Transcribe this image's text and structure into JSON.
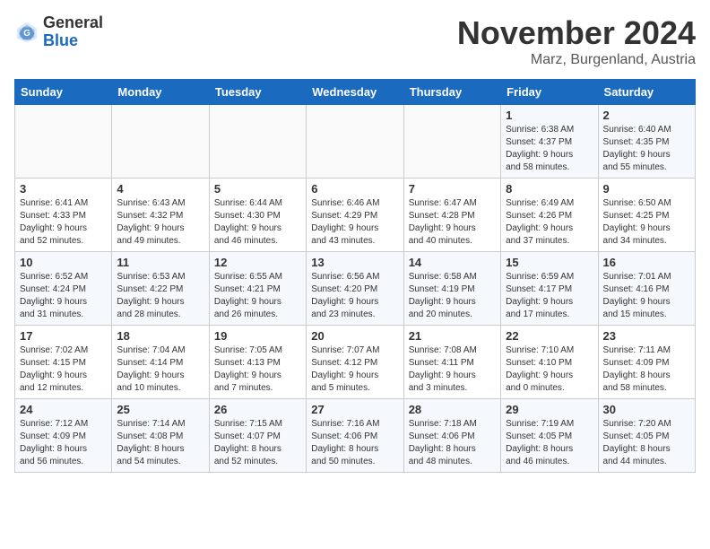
{
  "logo": {
    "general": "General",
    "blue": "Blue"
  },
  "title": "November 2024",
  "subtitle": "Marz, Burgenland, Austria",
  "weekdays": [
    "Sunday",
    "Monday",
    "Tuesday",
    "Wednesday",
    "Thursday",
    "Friday",
    "Saturday"
  ],
  "weeks": [
    [
      {
        "day": "",
        "info": ""
      },
      {
        "day": "",
        "info": ""
      },
      {
        "day": "",
        "info": ""
      },
      {
        "day": "",
        "info": ""
      },
      {
        "day": "",
        "info": ""
      },
      {
        "day": "1",
        "info": "Sunrise: 6:38 AM\nSunset: 4:37 PM\nDaylight: 9 hours\nand 58 minutes."
      },
      {
        "day": "2",
        "info": "Sunrise: 6:40 AM\nSunset: 4:35 PM\nDaylight: 9 hours\nand 55 minutes."
      }
    ],
    [
      {
        "day": "3",
        "info": "Sunrise: 6:41 AM\nSunset: 4:33 PM\nDaylight: 9 hours\nand 52 minutes."
      },
      {
        "day": "4",
        "info": "Sunrise: 6:43 AM\nSunset: 4:32 PM\nDaylight: 9 hours\nand 49 minutes."
      },
      {
        "day": "5",
        "info": "Sunrise: 6:44 AM\nSunset: 4:30 PM\nDaylight: 9 hours\nand 46 minutes."
      },
      {
        "day": "6",
        "info": "Sunrise: 6:46 AM\nSunset: 4:29 PM\nDaylight: 9 hours\nand 43 minutes."
      },
      {
        "day": "7",
        "info": "Sunrise: 6:47 AM\nSunset: 4:28 PM\nDaylight: 9 hours\nand 40 minutes."
      },
      {
        "day": "8",
        "info": "Sunrise: 6:49 AM\nSunset: 4:26 PM\nDaylight: 9 hours\nand 37 minutes."
      },
      {
        "day": "9",
        "info": "Sunrise: 6:50 AM\nSunset: 4:25 PM\nDaylight: 9 hours\nand 34 minutes."
      }
    ],
    [
      {
        "day": "10",
        "info": "Sunrise: 6:52 AM\nSunset: 4:24 PM\nDaylight: 9 hours\nand 31 minutes."
      },
      {
        "day": "11",
        "info": "Sunrise: 6:53 AM\nSunset: 4:22 PM\nDaylight: 9 hours\nand 28 minutes."
      },
      {
        "day": "12",
        "info": "Sunrise: 6:55 AM\nSunset: 4:21 PM\nDaylight: 9 hours\nand 26 minutes."
      },
      {
        "day": "13",
        "info": "Sunrise: 6:56 AM\nSunset: 4:20 PM\nDaylight: 9 hours\nand 23 minutes."
      },
      {
        "day": "14",
        "info": "Sunrise: 6:58 AM\nSunset: 4:19 PM\nDaylight: 9 hours\nand 20 minutes."
      },
      {
        "day": "15",
        "info": "Sunrise: 6:59 AM\nSunset: 4:17 PM\nDaylight: 9 hours\nand 17 minutes."
      },
      {
        "day": "16",
        "info": "Sunrise: 7:01 AM\nSunset: 4:16 PM\nDaylight: 9 hours\nand 15 minutes."
      }
    ],
    [
      {
        "day": "17",
        "info": "Sunrise: 7:02 AM\nSunset: 4:15 PM\nDaylight: 9 hours\nand 12 minutes."
      },
      {
        "day": "18",
        "info": "Sunrise: 7:04 AM\nSunset: 4:14 PM\nDaylight: 9 hours\nand 10 minutes."
      },
      {
        "day": "19",
        "info": "Sunrise: 7:05 AM\nSunset: 4:13 PM\nDaylight: 9 hours\nand 7 minutes."
      },
      {
        "day": "20",
        "info": "Sunrise: 7:07 AM\nSunset: 4:12 PM\nDaylight: 9 hours\nand 5 minutes."
      },
      {
        "day": "21",
        "info": "Sunrise: 7:08 AM\nSunset: 4:11 PM\nDaylight: 9 hours\nand 3 minutes."
      },
      {
        "day": "22",
        "info": "Sunrise: 7:10 AM\nSunset: 4:10 PM\nDaylight: 9 hours\nand 0 minutes."
      },
      {
        "day": "23",
        "info": "Sunrise: 7:11 AM\nSunset: 4:09 PM\nDaylight: 8 hours\nand 58 minutes."
      }
    ],
    [
      {
        "day": "24",
        "info": "Sunrise: 7:12 AM\nSunset: 4:09 PM\nDaylight: 8 hours\nand 56 minutes."
      },
      {
        "day": "25",
        "info": "Sunrise: 7:14 AM\nSunset: 4:08 PM\nDaylight: 8 hours\nand 54 minutes."
      },
      {
        "day": "26",
        "info": "Sunrise: 7:15 AM\nSunset: 4:07 PM\nDaylight: 8 hours\nand 52 minutes."
      },
      {
        "day": "27",
        "info": "Sunrise: 7:16 AM\nSunset: 4:06 PM\nDaylight: 8 hours\nand 50 minutes."
      },
      {
        "day": "28",
        "info": "Sunrise: 7:18 AM\nSunset: 4:06 PM\nDaylight: 8 hours\nand 48 minutes."
      },
      {
        "day": "29",
        "info": "Sunrise: 7:19 AM\nSunset: 4:05 PM\nDaylight: 8 hours\nand 46 minutes."
      },
      {
        "day": "30",
        "info": "Sunrise: 7:20 AM\nSunset: 4:05 PM\nDaylight: 8 hours\nand 44 minutes."
      }
    ]
  ]
}
